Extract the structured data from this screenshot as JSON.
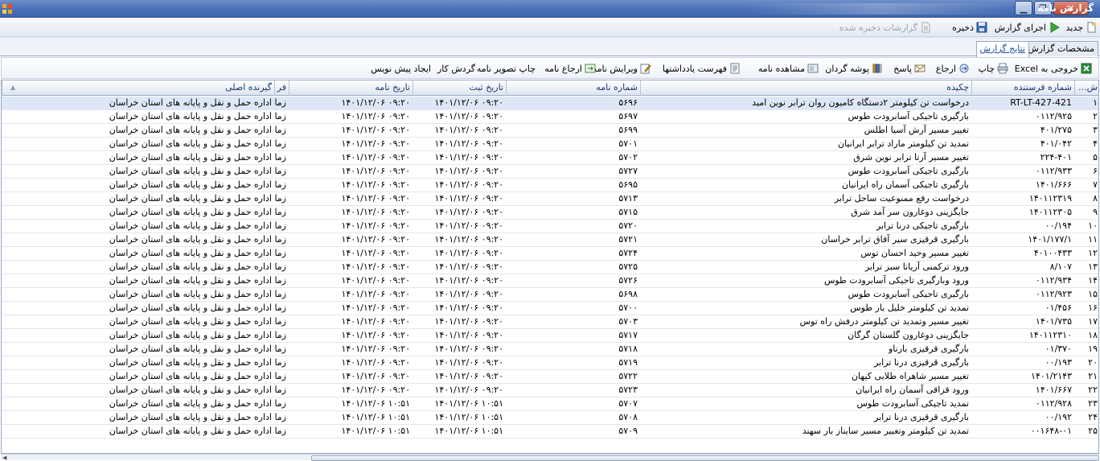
{
  "window": {
    "title": "گزارش نامه"
  },
  "toolbar1": {
    "new": "جدید",
    "run": "اجرای گزارش",
    "save": "ذخیره",
    "saved_reports": "گزارشات ذخیره شده"
  },
  "tabs": [
    {
      "label": "مشخصات گزارش"
    },
    {
      "label": "نتایج گزارش"
    }
  ],
  "toolbar2": {
    "excel": "خروجی به Excel",
    "print": "چاپ",
    "refer": "ارجاع",
    "reply": "پاسخ",
    "folder": "پوشه گردان",
    "view": "مشاهده نامه",
    "notes": "فهرست یادداشتها",
    "edit": "ویرایش نامه",
    "refer_letter": "ارجاع نامه",
    "print_image": "چاپ تصویر نامه",
    "workflow": "گردش کار",
    "draft": "ایجاد پیش نویس"
  },
  "grid": {
    "headers": {
      "row": "ش...",
      "sender_no": "شماره فرستنده",
      "summary": "چکیده",
      "letter_no": "شماره نامه",
      "reg_date": "تاریخ ثبت",
      "letter_date": "تاریخ نامه",
      "sender": "فر",
      "recipient": "گیرنده اصلی"
    },
    "rows": [
      {
        "n": "۱",
        "sender_no": "RT-LT-427-421",
        "summary": "درخواست تن کیلومتر ۲دستگاه کامیون روان ترابر نوین امید",
        "letter_no": "۵۶۹۶",
        "reg_date": "۱۴۰۱/۱۲/۰۶ ۰۹:۲۰",
        "letter_date": "۱۴۰۱/۱۲/۰۶ ۰۹:۲۰",
        "sender": "زما",
        "recipient": "اداره حمل و نقل و پایانه های استان خراسان"
      },
      {
        "n": "۲",
        "sender_no": "۰۱۱۲/۹۲۵",
        "summary": "بارگیری تاجیکی آسابرودت طوس",
        "letter_no": "۵۶۹۷",
        "reg_date": "۱۴۰۱/۱۲/۰۶ ۰۹:۲۰",
        "letter_date": "۱۴۰۱/۱۲/۰۶ ۰۹:۲۰",
        "sender": "زما",
        "recipient": "اداره حمل و نقل و پایانه های استان خراسان"
      },
      {
        "n": "۳",
        "sender_no": "۴۰۱/۲۷۵",
        "summary": "تغییر مسیر آرش آسیا اطلس",
        "letter_no": "۵۶۹۹",
        "reg_date": "۱۴۰۱/۱۲/۰۶ ۰۹:۲۰",
        "letter_date": "۱۴۰۱/۱۲/۰۶ ۰۹:۲۰",
        "sender": "زما",
        "recipient": "اداره حمل و نقل و پایانه های استان خراسان"
      },
      {
        "n": "۴",
        "sender_no": "۴۰۱/۰۴۲",
        "summary": "تمدید تن کیلومتر ماراد ترابر ایرانیان",
        "letter_no": "۵۷۰۱",
        "reg_date": "۱۴۰۱/۱۲/۰۶ ۰۹:۲۰",
        "letter_date": "۱۴۰۱/۱۲/۰۶ ۰۹:۲۰",
        "sender": "زما",
        "recipient": "اداره حمل و نقل و پایانه های استان خراسان"
      },
      {
        "n": "۵",
        "sender_no": "۲۲۴-۴۰۱",
        "summary": "تغییر مسیر آرتا ترابر نوین شرق",
        "letter_no": "۵۷۰۲",
        "reg_date": "۱۴۰۱/۱۲/۰۶ ۰۹:۲۰",
        "letter_date": "۱۴۰۱/۱۲/۰۶ ۰۹:۲۰",
        "sender": "زما",
        "recipient": "اداره حمل و نقل و پایانه های استان خراسان"
      },
      {
        "n": "۶",
        "sender_no": "۰۱۱۲/۹۳۳",
        "summary": "بارگیری تاجیکی آسابرودت طوس",
        "letter_no": "۵۷۲۷",
        "reg_date": "۱۴۰۱/۱۲/۰۶ ۰۹:۲۰",
        "letter_date": "۱۴۰۱/۱۲/۰۶ ۰۹:۲۰",
        "sender": "زما",
        "recipient": "اداره حمل و نقل و پایانه های استان خراسان"
      },
      {
        "n": "۷",
        "sender_no": "۱۴۰۱/۶۶۶",
        "summary": "بارگیری تاجیکی آسمان راه ایرانیان",
        "letter_no": "۵۶۹۵",
        "reg_date": "۱۴۰۱/۱۲/۰۶ ۰۹:۲۰",
        "letter_date": "۱۴۰۱/۱۲/۰۶ ۰۹:۲۰",
        "sender": "زما",
        "recipient": "اداره حمل و نقل و پایانه های استان خراسان"
      },
      {
        "n": "۸",
        "sender_no": "۱۴۰۱۱۲۳۱۹",
        "summary": "درخواست رفع ممنوعیت ساحل ترابر",
        "letter_no": "۵۷۱۳",
        "reg_date": "۱۴۰۱/۱۲/۰۶ ۰۹:۲۰",
        "letter_date": "۱۴۰۱/۱۲/۰۶ ۰۹:۲۰",
        "sender": "زما",
        "recipient": "اداره حمل و نقل و پایانه های استان خراسان"
      },
      {
        "n": "۹",
        "sender_no": "۱۴۰۱۱۲۳۰۵",
        "summary": "جایگزینی دوغارون سر آمد شرق",
        "letter_no": "۵۷۱۵",
        "reg_date": "۱۴۰۱/۱۲/۰۶ ۰۹:۲۰",
        "letter_date": "۱۴۰۱/۱۲/۰۶ ۰۹:۲۰",
        "sender": "زما",
        "recipient": "اداره حمل و نقل و پایانه های استان خراسان"
      },
      {
        "n": "۱۰",
        "sender_no": "۰۰/۱۹۴",
        "summary": "بارگیری تاجیکی درنا ترابر",
        "letter_no": "۵۷۲۰",
        "reg_date": "۱۴۰۱/۱۲/۰۶ ۰۹:۲۰",
        "letter_date": "۱۴۰۱/۱۲/۰۶ ۰۹:۲۰",
        "sender": "زما",
        "recipient": "اداره حمل و نقل و پایانه های استان خراسان"
      },
      {
        "n": "۱۱",
        "sender_no": "۱۴۰۱/۱۷۷/۱",
        "summary": "بارگیری قرقیزی سیر آفاق ترابر خراسان",
        "letter_no": "۵۷۲۱",
        "reg_date": "۱۴۰۱/۱۲/۰۶ ۰۹:۲۰",
        "letter_date": "۱۴۰۱/۱۲/۰۶ ۰۹:۲۰",
        "sender": "زما",
        "recipient": "اداره حمل و نقل و پایانه های استان خراسان"
      },
      {
        "n": "۱۲",
        "sender_no": "۴۰۱۰۰۴۳۳",
        "summary": "تغییر مسیر وحید احسان توس",
        "letter_no": "۵۷۲۴",
        "reg_date": "۱۴۰۱/۱۲/۰۶ ۰۹:۲۰",
        "letter_date": "۱۴۰۱/۱۲/۰۶ ۰۹:۲۰",
        "sender": "زما",
        "recipient": "اداره حمل و نقل و پایانه های استان خراسان"
      },
      {
        "n": "۱۳",
        "sender_no": "۸/۱۰۷",
        "summary": "ورود ترکمنی آریانا سبز ترابر",
        "letter_no": "۵۷۲۵",
        "reg_date": "۱۴۰۱/۱۲/۰۶ ۰۹:۲۰",
        "letter_date": "۱۴۰۱/۱۲/۰۶ ۰۹:۲۰",
        "sender": "زما",
        "recipient": "اداره حمل و نقل و پایانه های استان خراسان"
      },
      {
        "n": "۱۴",
        "sender_no": "۰۱۱۲/۹۳۴",
        "summary": "ورود وبارگیری تاجیکی آسابرودت طوس",
        "letter_no": "۵۷۲۶",
        "reg_date": "۱۴۰۱/۱۲/۰۶ ۰۹:۲۰",
        "letter_date": "۱۴۰۱/۱۲/۰۶ ۰۹:۲۰",
        "sender": "زما",
        "recipient": "اداره حمل و نقل و پایانه های استان خراسان"
      },
      {
        "n": "۱۵",
        "sender_no": "۰۱۱۲/۹۲۳",
        "summary": "بارگیری تاجیکی آسابرودت طوس",
        "letter_no": "۵۶۹۸",
        "reg_date": "۱۴۰۱/۱۲/۰۶ ۰۹:۲۰",
        "letter_date": "۱۴۰۱/۱۲/۰۶ ۰۹:۲۰",
        "sender": "زما",
        "recipient": "اداره حمل و نقل و پایانه های استان خراسان"
      },
      {
        "n": "۱۶",
        "sender_no": "۰۱/۴۵۶",
        "summary": "تمدید تن کیلومتر خلیل بار طوس",
        "letter_no": "۵۷۰۰",
        "reg_date": "۱۴۰۱/۱۲/۰۶ ۰۹:۲۰",
        "letter_date": "۱۴۰۱/۱۲/۰۶ ۰۹:۲۰",
        "sender": "زما",
        "recipient": "اداره حمل و نقل و پایانه های استان خراسان"
      },
      {
        "n": "۱۷",
        "sender_no": "۱۴۰۱/۷۳۵",
        "summary": "تغییر مسیر وتمدید تن کیلومتر درفش راه توس",
        "letter_no": "۵۷۰۳",
        "reg_date": "۱۴۰۱/۱۲/۰۶ ۰۹:۲۰",
        "letter_date": "۱۴۰۱/۱۲/۰۶ ۰۹:۲۰",
        "sender": "زما",
        "recipient": "اداره حمل و نقل و پایانه های استان خراسان"
      },
      {
        "n": "۱۸",
        "sender_no": "۱۴۰۱۱۲۳۱۰",
        "summary": "جایگزینی دوغارون گلستان گرگان",
        "letter_no": "۵۷۱۷",
        "reg_date": "۱۴۰۱/۱۲/۰۶ ۰۹:۲۰",
        "letter_date": "۱۴۰۱/۱۲/۰۶ ۰۹:۲۰",
        "sender": "زما",
        "recipient": "اداره حمل و نقل و پایانه های استان خراسان"
      },
      {
        "n": "۱۹",
        "sender_no": "۰۱/۳۷۰",
        "summary": "بارگیری قرقیزی بارناو",
        "letter_no": "۵۷۱۸",
        "reg_date": "۱۴۰۱/۱۲/۰۶ ۰۹:۲۰",
        "letter_date": "۱۴۰۱/۱۲/۰۶ ۰۹:۲۰",
        "sender": "زما",
        "recipient": "اداره حمل و نقل و پایانه های استان خراسان"
      },
      {
        "n": "۲۰",
        "sender_no": "۰۰/۱۹۳",
        "summary": "بارگیری قرقیزی درنا ترابر",
        "letter_no": "۵۷۱۹",
        "reg_date": "۱۴۰۱/۱۲/۰۶ ۰۹:۲۰",
        "letter_date": "۱۴۰۱/۱۲/۰۶ ۰۹:۲۰",
        "sender": "زما",
        "recipient": "اداره حمل و نقل و پایانه های استان خراسان"
      },
      {
        "n": "۲۱",
        "sender_no": "۱۴۰۱/۲۱۴۳",
        "summary": "تغییر مسیر شاهراه طلایی کیهان",
        "letter_no": "۵۷۲۲",
        "reg_date": "۱۴۰۱/۱۲/۰۶ ۰۹:۲۰",
        "letter_date": "۱۴۰۱/۱۲/۰۶ ۰۹:۲۰",
        "sender": "زما",
        "recipient": "اداره حمل و نقل و پایانه های استان خراسان"
      },
      {
        "n": "۲۲",
        "sender_no": "۱۴۰۱/۶۶۷",
        "summary": "ورود قزاقی آسمان راه ایرانیان",
        "letter_no": "۵۷۲۳",
        "reg_date": "۱۴۰۱/۱۲/۰۶ ۰۹:۲۰",
        "letter_date": "۱۴۰۱/۱۲/۰۶ ۰۹:۲۰",
        "sender": "زما",
        "recipient": "اداره حمل و نقل و پایانه های استان خراسان"
      },
      {
        "n": "۲۳",
        "sender_no": "۰۱۱۲/۹۲۸",
        "summary": "تمدید تاجیکی آسابرودت طوس",
        "letter_no": "۵۷۰۷",
        "reg_date": "۱۴۰۱/۱۲/۰۶ ۱۰:۵۱",
        "letter_date": "۱۴۰۱/۱۲/۰۶ ۱۰:۵۱",
        "sender": "زما",
        "recipient": "اداره حمل و نقل و پایانه های استان خراسان"
      },
      {
        "n": "۲۴",
        "sender_no": "۰۰/۱۹۲",
        "summary": "بارگیری قرقیزی درنا ترابر",
        "letter_no": "۵۷۰۸",
        "reg_date": "۱۴۰۱/۱۲/۰۶ ۱۰:۵۱",
        "letter_date": "۱۴۰۱/۱۲/۰۶ ۱۰:۵۱",
        "sender": "زما",
        "recipient": "اداره حمل و نقل و پایانه های استان خراسان"
      },
      {
        "n": "۲۵",
        "sender_no": "۰۰۱۶۴۸-۰۱",
        "summary": "تمدید تن کیلومتر وتغییر مسیر سایناز بار سهند",
        "letter_no": "۵۷۰۹",
        "reg_date": "۱۴۰۱/۱۲/۰۶ ۱۰:۵۱",
        "letter_date": "۱۴۰۱/۱۲/۰۶ ۱۰:۵۱",
        "sender": "زما",
        "recipient": "اداره حمل و نقل و پایانه های استان خراسان"
      }
    ]
  }
}
